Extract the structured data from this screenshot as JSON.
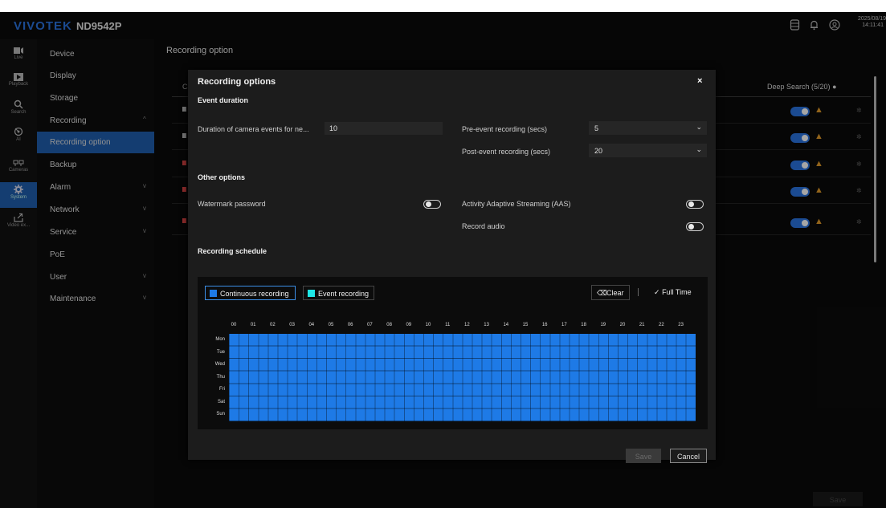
{
  "header": {
    "brand": "VIVOTEK",
    "model": "ND9542P",
    "date": "2025/08/19",
    "time": "14:11:41",
    "icons": [
      "storage-icon",
      "bell-icon",
      "user-icon"
    ]
  },
  "rail": {
    "items": [
      {
        "label": "Live",
        "icon": "camera-icon"
      },
      {
        "label": "Playback",
        "icon": "play-icon"
      },
      {
        "label": "Search",
        "icon": "search-icon"
      },
      {
        "label": "AI",
        "icon": "ai-icon"
      },
      {
        "label": "Cameras",
        "icon": "cameras-icon"
      },
      {
        "label": "System",
        "icon": "gear-icon",
        "active": true
      },
      {
        "label": "Video ex...",
        "icon": "export-icon"
      }
    ]
  },
  "menu": {
    "items": [
      {
        "label": "Device"
      },
      {
        "label": "Display"
      },
      {
        "label": "Storage"
      },
      {
        "label": "Recording",
        "expanded": true
      },
      {
        "label": "Recording option",
        "active": true
      },
      {
        "label": "Backup"
      },
      {
        "label": "Alarm",
        "collapsed": true
      },
      {
        "label": "Network",
        "collapsed": true
      },
      {
        "label": "Service",
        "collapsed": true
      },
      {
        "label": "PoE"
      },
      {
        "label": "User",
        "collapsed": true
      },
      {
        "label": "Maintenance",
        "collapsed": true
      }
    ]
  },
  "page": {
    "title": "Recording option",
    "table_head_partial": "Ca",
    "deep_search_header": "Deep Search (5/20)",
    "rows": 5,
    "save_label": "Save"
  },
  "modal": {
    "title": "Recording options",
    "event_duration_heading": "Event duration",
    "duration_label": "Duration of camera events for ne...",
    "duration_value": "10",
    "pre_event_label": "Pre-event recording (secs)",
    "pre_event_value": "5",
    "post_event_label": "Post-event recording (secs)",
    "post_event_value": "20",
    "other_heading": "Other options",
    "watermark_label": "Watermark password",
    "watermark_on": false,
    "aas_label": "Activity Adaptive Streaming (AAS)",
    "aas_on": false,
    "audio_label": "Record audio",
    "audio_on": false,
    "schedule_heading": "Recording schedule",
    "legend_continuous": "Continuous recording",
    "legend_event": "Event recording",
    "clear_label": "Clear",
    "fulltime_label": "Full Time",
    "hours": [
      "00",
      "01",
      "02",
      "03",
      "04",
      "05",
      "06",
      "07",
      "08",
      "09",
      "10",
      "11",
      "12",
      "13",
      "14",
      "15",
      "16",
      "17",
      "18",
      "19",
      "20",
      "21",
      "22",
      "23"
    ],
    "days": [
      "Mon",
      "Tue",
      "Wed",
      "Thu",
      "Fri",
      "Sat",
      "Sun"
    ],
    "save_label": "Save",
    "cancel_label": "Cancel"
  },
  "colors": {
    "accent": "#1f5fae",
    "continuous": "#1e7ae6",
    "event": "#1ee6e6",
    "warning": "#e09a2a"
  }
}
